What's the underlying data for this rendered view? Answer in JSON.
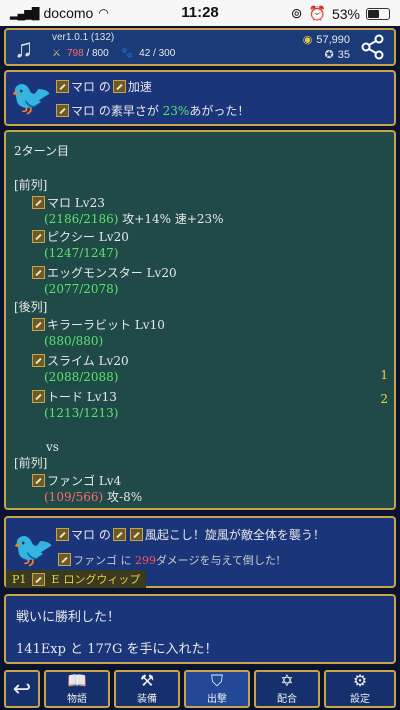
{
  "statusbar": {
    "carrier": "docomo",
    "time": "11:28",
    "battery": "53%"
  },
  "header": {
    "version": "ver1.0.1 (132)",
    "hp_current": "798",
    "hp_max": "/ 800",
    "paw_current": "42",
    "paw_max": "/ 300",
    "gold": "57,990",
    "gems": "35"
  },
  "event1": {
    "name": "マロ",
    "prefix": "の",
    "skill": "加速",
    "line2_a": "マロ の素早さが ",
    "line2_pct": "23%",
    "line2_b": "あがった！"
  },
  "log": {
    "turn": "2ターン目",
    "front_label": "[前列]",
    "back_label": "[後列]",
    "vs": "vs",
    "enemy_label": "[前列]",
    "allies": [
      {
        "name": "マロ Lv23",
        "hp": "(2186/2186)",
        "buff": " 攻+14% 速+23%"
      },
      {
        "name": "ピクシー Lv20",
        "hp": "(1247/1247)",
        "buff": ""
      },
      {
        "name": "エッグモンスター Lv20",
        "hp": "(2077/2078)",
        "buff": ""
      }
    ],
    "back": [
      {
        "name": "キラーラビット Lv10",
        "hp": "(880/880)"
      },
      {
        "name": "スライム Lv20",
        "hp": "(2088/2088)",
        "idx": "1"
      },
      {
        "name": "トード Lv13",
        "hp": "(1213/1213)",
        "idx": "2"
      }
    ],
    "enemy": {
      "name": "ファンゴ Lv4",
      "hp": "(109/566)",
      "debuff": " 攻-8%"
    }
  },
  "event2": {
    "line1_a": "マロ の",
    "line1_b": "風起こし！旋風が敵全体を襲う！",
    "line2_a": "ファンゴ に ",
    "line2_dmg": "299",
    "line2_b": "ダメージを与えて倒した!",
    "tag_p": "P1",
    "tag_e": "E",
    "tag_name": "ロングウィップ"
  },
  "message": {
    "line1": "戦いに勝利した！",
    "line2": "141Exp と 177G を手に入れた！"
  },
  "nav": {
    "story": "物語",
    "equip": "装備",
    "sortie": "出撃",
    "combine": "配合",
    "settings": "設定"
  }
}
